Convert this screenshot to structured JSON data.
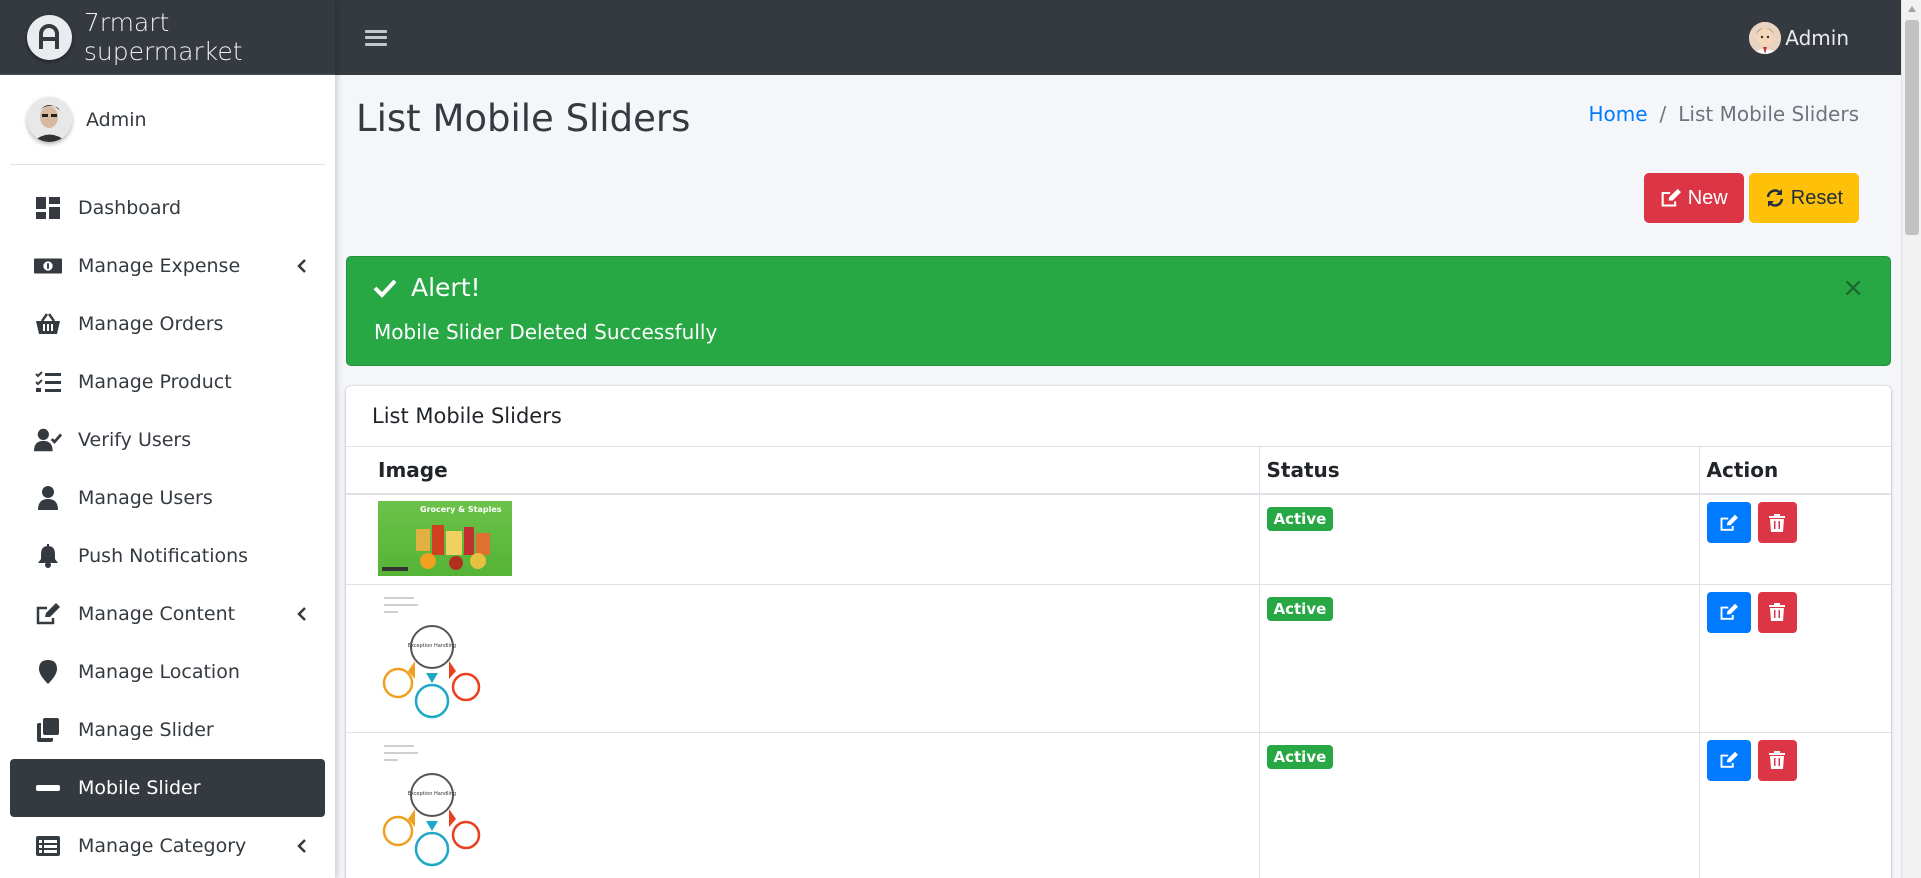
{
  "brand": {
    "name": "7rmart supermarket"
  },
  "sidebar": {
    "user_name": "Admin",
    "items": [
      {
        "label": "Dashboard",
        "icon": "dashboard-icon",
        "has_submenu": false,
        "active": false
      },
      {
        "label": "Manage Expense",
        "icon": "money-bill-icon",
        "has_submenu": true,
        "active": false
      },
      {
        "label": "Manage Orders",
        "icon": "basket-icon",
        "has_submenu": false,
        "active": false
      },
      {
        "label": "Manage Product",
        "icon": "tasks-list-icon",
        "has_submenu": false,
        "active": false
      },
      {
        "label": "Verify Users",
        "icon": "user-check-icon",
        "has_submenu": false,
        "active": false
      },
      {
        "label": "Manage Users",
        "icon": "user-icon",
        "has_submenu": false,
        "active": false
      },
      {
        "label": "Push Notifications",
        "icon": "bell-icon",
        "has_submenu": false,
        "active": false
      },
      {
        "label": "Manage Content",
        "icon": "edit-icon",
        "has_submenu": true,
        "active": false
      },
      {
        "label": "Manage Location",
        "icon": "map-marker-icon",
        "has_submenu": false,
        "active": false
      },
      {
        "label": "Manage Slider",
        "icon": "clone-icon",
        "has_submenu": false,
        "active": false
      },
      {
        "label": "Mobile Slider",
        "icon": "minus-icon",
        "has_submenu": false,
        "active": true
      },
      {
        "label": "Manage Category",
        "icon": "list-alt-icon",
        "has_submenu": true,
        "active": false
      }
    ]
  },
  "topbar": {
    "user_name": "Admin"
  },
  "page": {
    "title": "List Mobile Sliders",
    "breadcrumb": {
      "home": "Home",
      "separator": "/",
      "current": "List Mobile Sliders"
    },
    "new_label": "New",
    "reset_label": "Reset"
  },
  "alert": {
    "title": "Alert!",
    "message": "Mobile Slider Deleted Successfully",
    "close": "×"
  },
  "table": {
    "card_title": "List Mobile Sliders",
    "headers": {
      "image": "Image",
      "status": "Status",
      "action": "Action"
    },
    "rows": [
      {
        "image": "grocery-staples-banner",
        "image_text": "Grocery & Staples",
        "status": "Active"
      },
      {
        "image": "exception-handling-diagram",
        "image_text": "Exception Handling",
        "status": "Active"
      },
      {
        "image": "exception-handling-diagram",
        "image_text": "Exception Handling",
        "status": "Active"
      }
    ]
  },
  "colors": {
    "navbar": "#343a40",
    "success": "#28a745",
    "danger": "#dc3545",
    "warning": "#ffc107",
    "primary": "#007bff"
  }
}
